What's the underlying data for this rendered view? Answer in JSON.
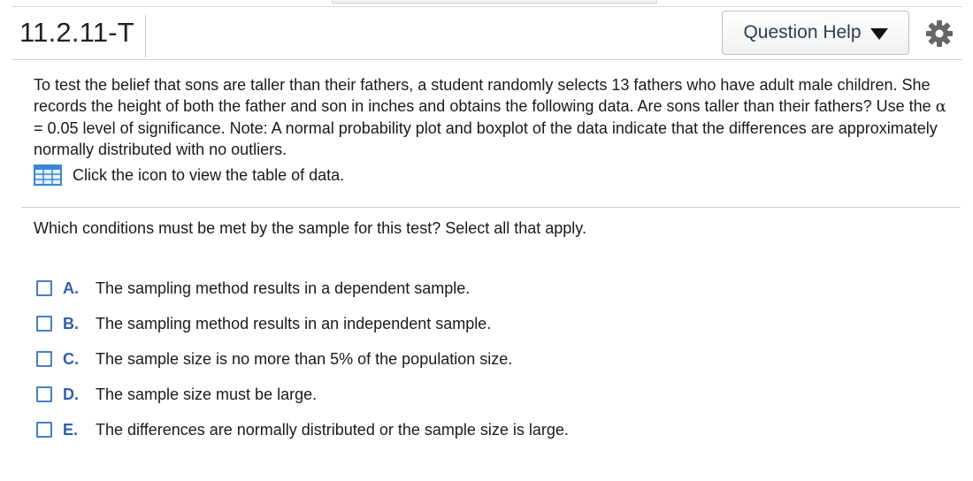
{
  "header": {
    "question_id": "11.2.11-T",
    "help_label": "Question Help"
  },
  "problem": {
    "text_before_alpha": "To test the belief that sons are taller than their fathers, a student randomly selects 13 fathers who have adult male children. She records the height of both the father and son in inches and obtains the following data. Are sons taller than their fathers? Use the ",
    "alpha_symbol": "α",
    "alpha_value": " = 0.05",
    "text_after_alpha": " level of significance. Note: A normal probability plot and boxplot of the data indicate that the differences are approximately normally distributed with no outliers.",
    "data_link": "Click the icon to view the table of data."
  },
  "instruction": "Which conditions must be met by the sample for this test? Select all that apply.",
  "options": [
    {
      "letter": "A.",
      "text": "The sampling method results in a dependent sample."
    },
    {
      "letter": "B.",
      "text": "The sampling method results in an independent sample."
    },
    {
      "letter": "C.",
      "text": "The sample size is no more than 5% of the population size."
    },
    {
      "letter": "D.",
      "text": "The sample size must be large."
    },
    {
      "letter": "E.",
      "text": "The differences are normally distributed or the sample size is large."
    }
  ],
  "icons": {
    "help_caret": "caret-down-icon",
    "settings": "gear-icon",
    "data_table": "table-icon"
  },
  "colors": {
    "option_letter": "#2f5fa8",
    "checkbox_border": "#4a7fc4",
    "table_icon": "#3a86d8"
  }
}
